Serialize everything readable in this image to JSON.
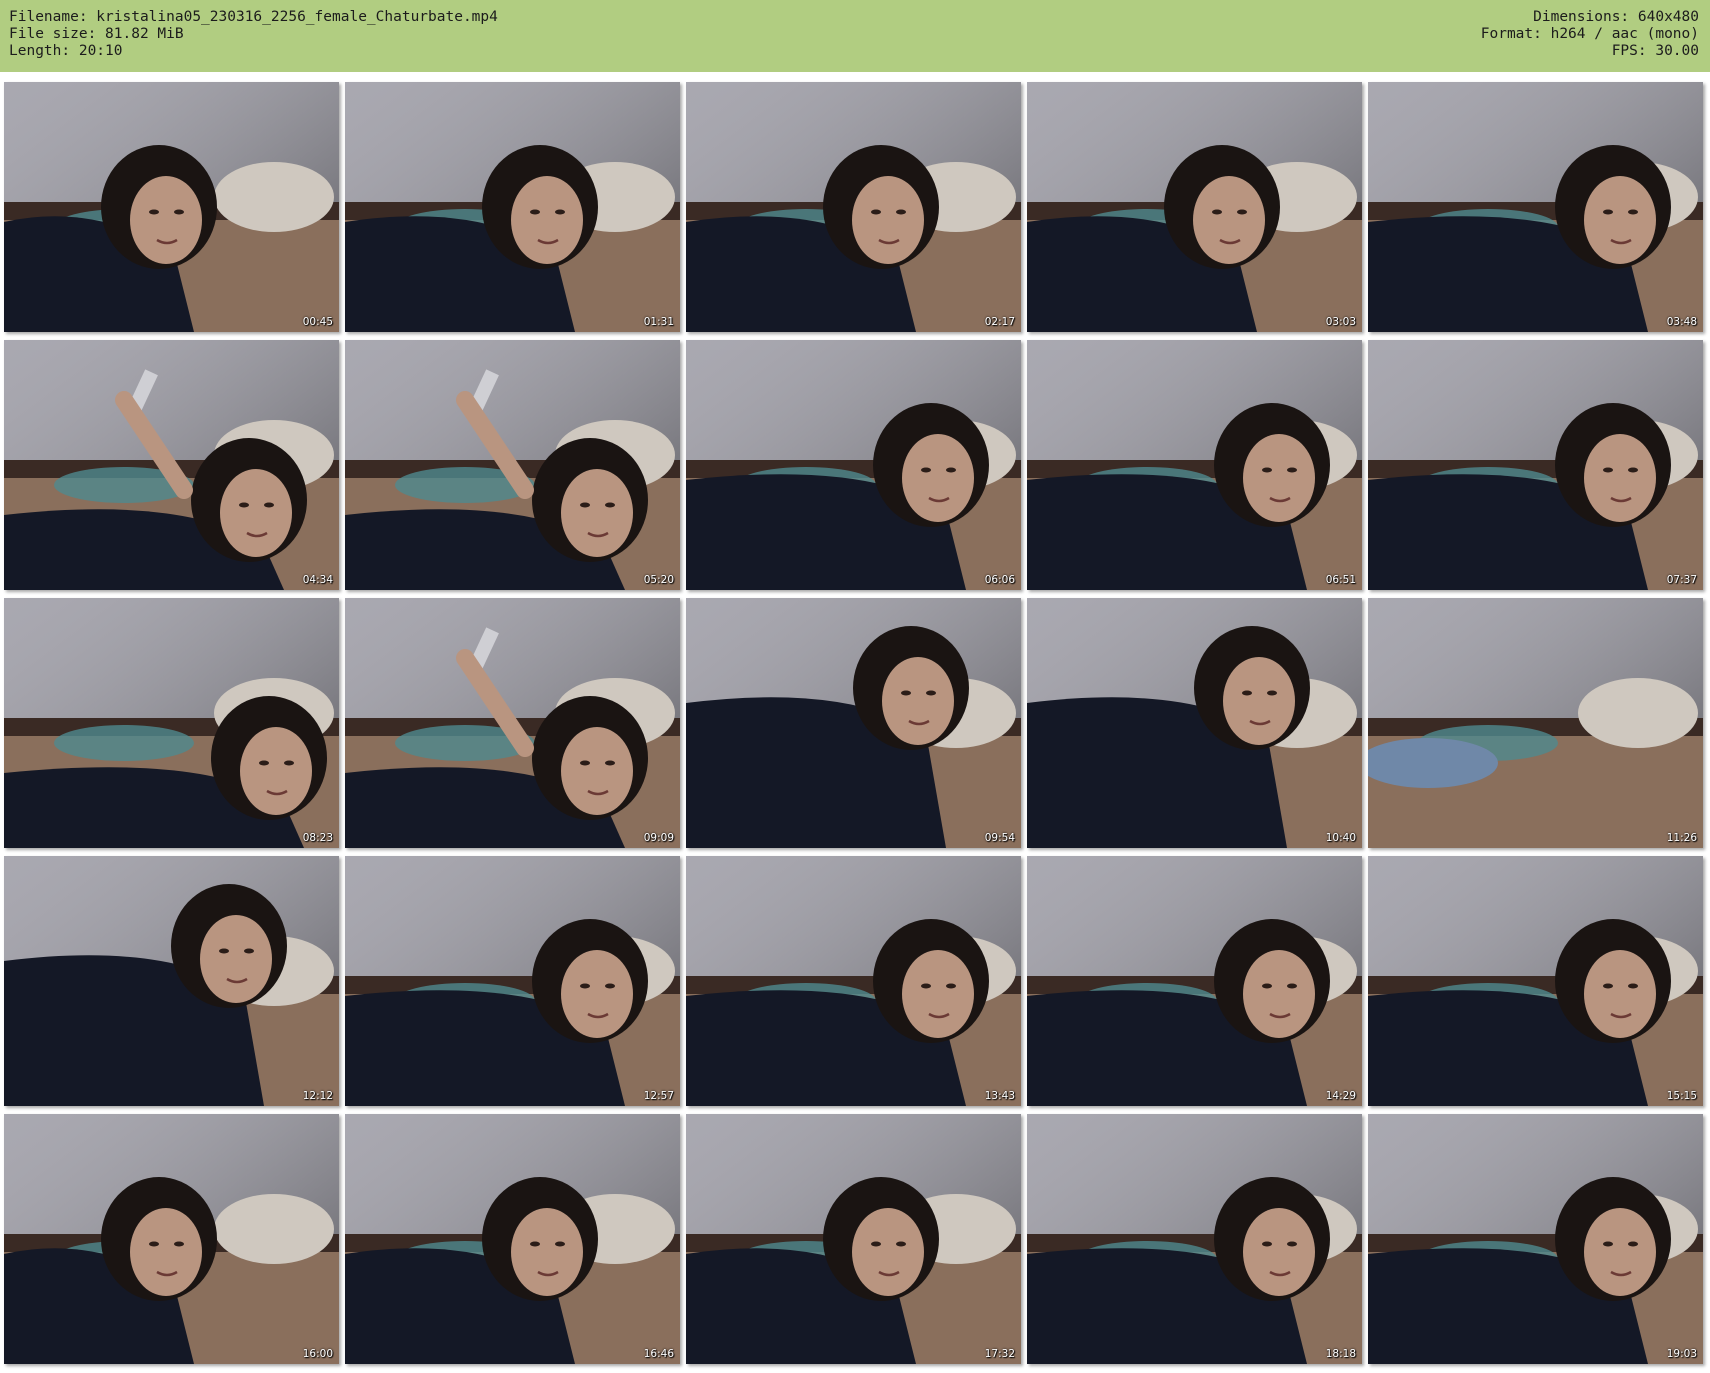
{
  "header": {
    "filename_line": "Filename: kristalina05_230316_2256_female_Chaturbate.mp4",
    "filesize_line": "File size: 81.82 MiB",
    "length_line": "Length: 20:10",
    "dimensions_line": "Dimensions: 640x480",
    "format_line": "Format: h264 / aac (mono)",
    "fps_line": "FPS: 30.00"
  },
  "colors": {
    "header_bg": "#b1cd81",
    "wall": "#9a99a3",
    "shirt": "#141826",
    "hair": "#1a1412",
    "skin": "#b99580",
    "bed": "#8a6f5c",
    "pillow": "#cfc8bf"
  },
  "thumbnails": [
    {
      "time": "00:45",
      "scene": "face-left"
    },
    {
      "time": "01:31",
      "scene": "face-center"
    },
    {
      "time": "02:17",
      "scene": "face-center"
    },
    {
      "time": "03:03",
      "scene": "face-center"
    },
    {
      "time": "03:48",
      "scene": "face-right"
    },
    {
      "time": "04:34",
      "scene": "lying-phone"
    },
    {
      "time": "05:20",
      "scene": "lying-phone"
    },
    {
      "time": "06:06",
      "scene": "face-right"
    },
    {
      "time": "06:51",
      "scene": "face-right"
    },
    {
      "time": "07:37",
      "scene": "face-right"
    },
    {
      "time": "08:23",
      "scene": "lying"
    },
    {
      "time": "09:09",
      "scene": "lying-phone"
    },
    {
      "time": "09:54",
      "scene": "lean-close"
    },
    {
      "time": "10:40",
      "scene": "lean-close"
    },
    {
      "time": "11:26",
      "scene": "empty-bed"
    },
    {
      "time": "12:12",
      "scene": "lean-close"
    },
    {
      "time": "12:57",
      "scene": "face-right"
    },
    {
      "time": "13:43",
      "scene": "face-right"
    },
    {
      "time": "14:29",
      "scene": "face-right"
    },
    {
      "time": "15:15",
      "scene": "face-right"
    },
    {
      "time": "16:00",
      "scene": "face-left"
    },
    {
      "time": "16:46",
      "scene": "face-center"
    },
    {
      "time": "17:32",
      "scene": "face-center"
    },
    {
      "time": "18:18",
      "scene": "face-right"
    },
    {
      "time": "19:03",
      "scene": "face-right"
    }
  ]
}
